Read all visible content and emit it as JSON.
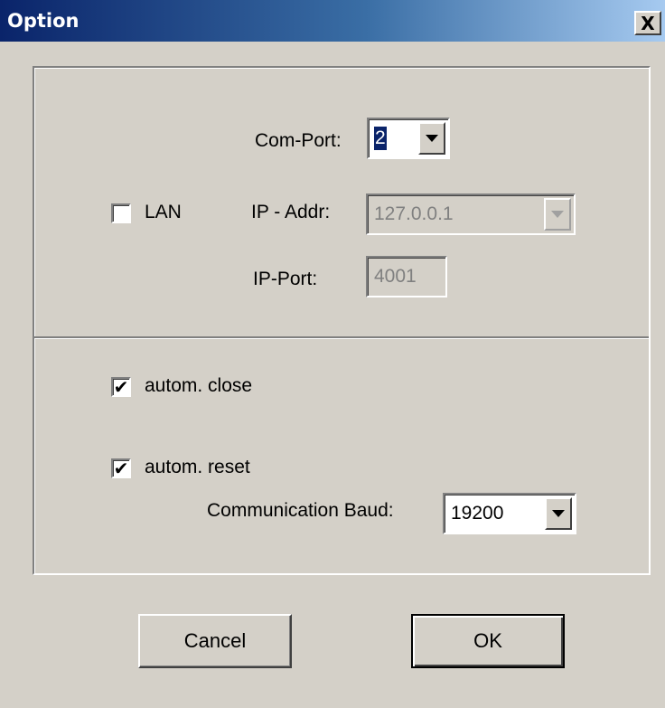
{
  "window": {
    "title": "Option",
    "close_label": "X"
  },
  "connection": {
    "com_port_label": "Com-Port:",
    "com_port_value": "2",
    "lan_label": "LAN",
    "lan_checked": false,
    "ip_addr_label": "IP - Addr:",
    "ip_addr_value": "127.0.0.1",
    "ip_port_label": "IP-Port:",
    "ip_port_value": "4001"
  },
  "options": {
    "auto_close_label": "autom. close",
    "auto_close_checked": true,
    "auto_reset_label": "autom. reset",
    "auto_reset_checked": true,
    "baud_label": "Communication Baud:",
    "baud_value": "19200"
  },
  "buttons": {
    "cancel_label": "Cancel",
    "ok_label": "OK"
  },
  "icons": {
    "checkmark": "✔",
    "dropdown": "chevron-down-icon"
  },
  "colors": {
    "title_start": "#0a246a",
    "title_end": "#a6caf0",
    "dialog_bg": "#d4d0c8",
    "selection": "#0a246a"
  }
}
